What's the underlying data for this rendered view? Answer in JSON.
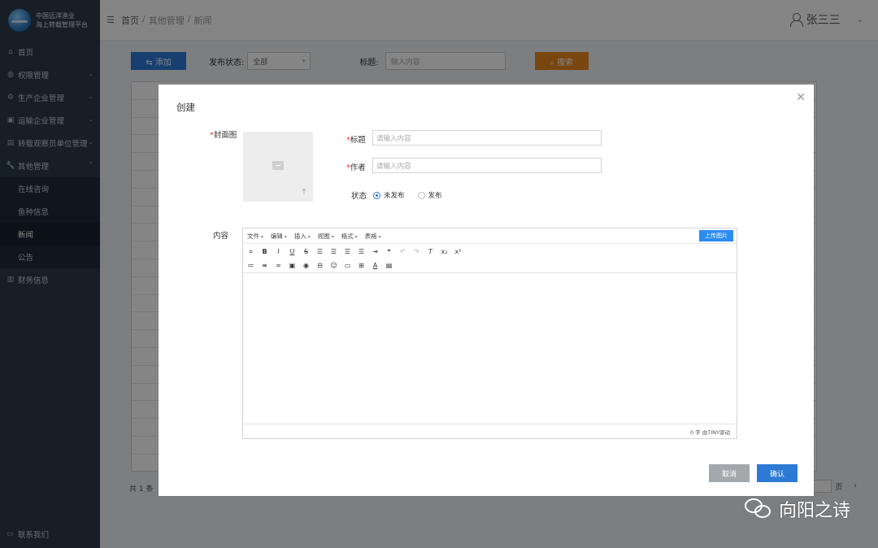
{
  "brand": {
    "line1": "中国远洋渔业",
    "line2": "海上转载管理平台"
  },
  "sidebar": {
    "items": [
      {
        "label": "首页",
        "icon": "home-icon"
      },
      {
        "label": "权限管理",
        "icon": "shield-icon"
      },
      {
        "label": "生产企业管理",
        "icon": "gear-icon"
      },
      {
        "label": "运输企业管理",
        "icon": "truck-icon"
      },
      {
        "label": "转载观察员单位管理",
        "icon": "user-group-icon"
      },
      {
        "label": "其他管理",
        "icon": "wrench-icon"
      }
    ],
    "submenu": [
      {
        "label": "在线咨询"
      },
      {
        "label": "鱼种信息"
      },
      {
        "label": "新闻"
      },
      {
        "label": "公告"
      }
    ],
    "finance": {
      "label": "财务信息",
      "icon": "chart-icon"
    },
    "footer": {
      "label": "联系我们",
      "icon": "message-icon"
    }
  },
  "header": {
    "breadcrumb": [
      "首页",
      "其他管理",
      "新闻"
    ],
    "separator": "/",
    "user_name": "张三三"
  },
  "main": {
    "add_label": "添加",
    "status_label": "发布状态:",
    "status_value": "全部",
    "title_label": "标题:",
    "title_placeholder": "输入内容",
    "search_label": "搜索",
    "total": "共 1 条",
    "page_suffix": "页"
  },
  "modal": {
    "title": "创建",
    "cover_label": "封面图",
    "title_field_label": "标题",
    "title_placeholder": "请输入内容",
    "author_label": "作者",
    "author_placeholder": "请输入内容",
    "status_label": "状态",
    "status_options": [
      "未发布",
      "发布"
    ],
    "content_label": "内容",
    "editor": {
      "menus": [
        "文件",
        "编辑",
        "插入",
        "视图",
        "格式",
        "表格"
      ],
      "upload_label": "上传图片",
      "status_text": "0 字 由TINY驱动"
    },
    "cancel_label": "取消",
    "confirm_label": "确认"
  },
  "watermark": {
    "text": "向阳之诗"
  },
  "colors": {
    "sidebar_bg": "#2b3a4a",
    "primary": "#2d7ad6",
    "search_orange": "#e8871e",
    "cancel_gray": "#a3a8ad",
    "required_red": "#e4393c"
  }
}
